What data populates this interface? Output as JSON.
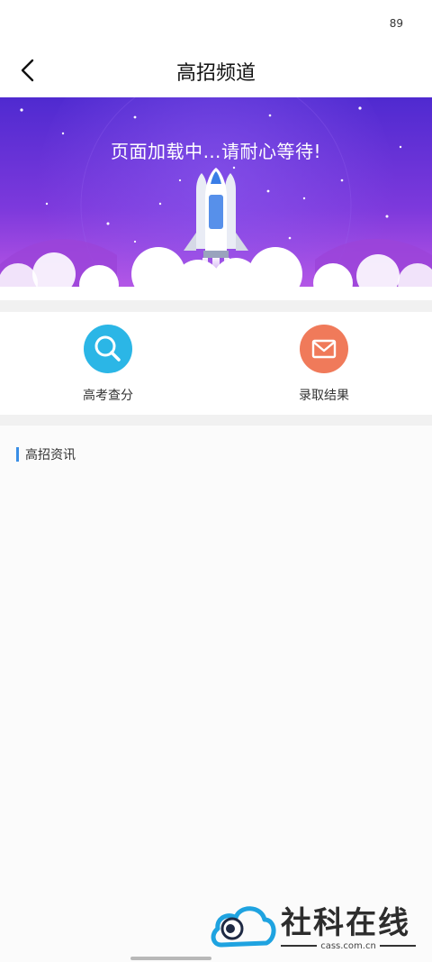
{
  "status_bar": {
    "battery": "89"
  },
  "nav": {
    "title": "高招频道",
    "back_icon": "chevron-left-icon"
  },
  "banner": {
    "loading_text": "页面加载中…请耐心等待!",
    "colors": {
      "top": "#5d2fd6",
      "bottom": "#b44fe0",
      "cloud": "#ffffff"
    }
  },
  "entries": [
    {
      "label": "高考查分",
      "icon": "search-icon",
      "color": "#2bb6e6"
    },
    {
      "label": "录取结果",
      "icon": "mail-icon",
      "color": "#f07a5a"
    }
  ],
  "news": {
    "section_title": "高招资讯",
    "accent": "#3a8ee6"
  },
  "watermark": {
    "brand": "社科在线",
    "url": "cass.com.cn"
  }
}
